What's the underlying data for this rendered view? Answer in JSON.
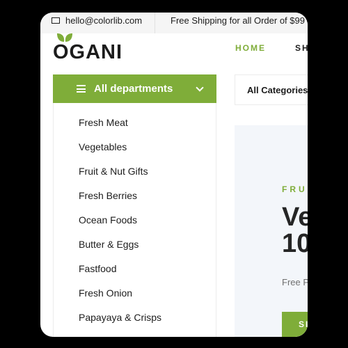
{
  "colors": {
    "accent": "#7fad39",
    "text": "#1c1c1c",
    "hero_bg": "#f3f6fa",
    "topbar_bg": "#f5f5f5"
  },
  "topbar": {
    "email": "hello@colorlib.com",
    "shipping": "Free Shipping for all Order of $99"
  },
  "logo": {
    "text": "OGANI"
  },
  "nav": {
    "items": [
      {
        "label": "HOME",
        "active": true
      },
      {
        "label": "SH",
        "active": false
      }
    ]
  },
  "departments": {
    "button_label": "All departments",
    "items": [
      "Fresh Meat",
      "Vegetables",
      "Fruit & Nut Gifts",
      "Fresh Berries",
      "Ocean Foods",
      "Butter & Eggs",
      "Fastfood",
      "Fresh Onion",
      "Papayaya & Crisps"
    ]
  },
  "search": {
    "category_label": "All Categories"
  },
  "hero": {
    "tag": "FRUI",
    "title_line1": "Ve",
    "title_line2": "10",
    "subtitle": "Free P",
    "button_label": "SI"
  }
}
